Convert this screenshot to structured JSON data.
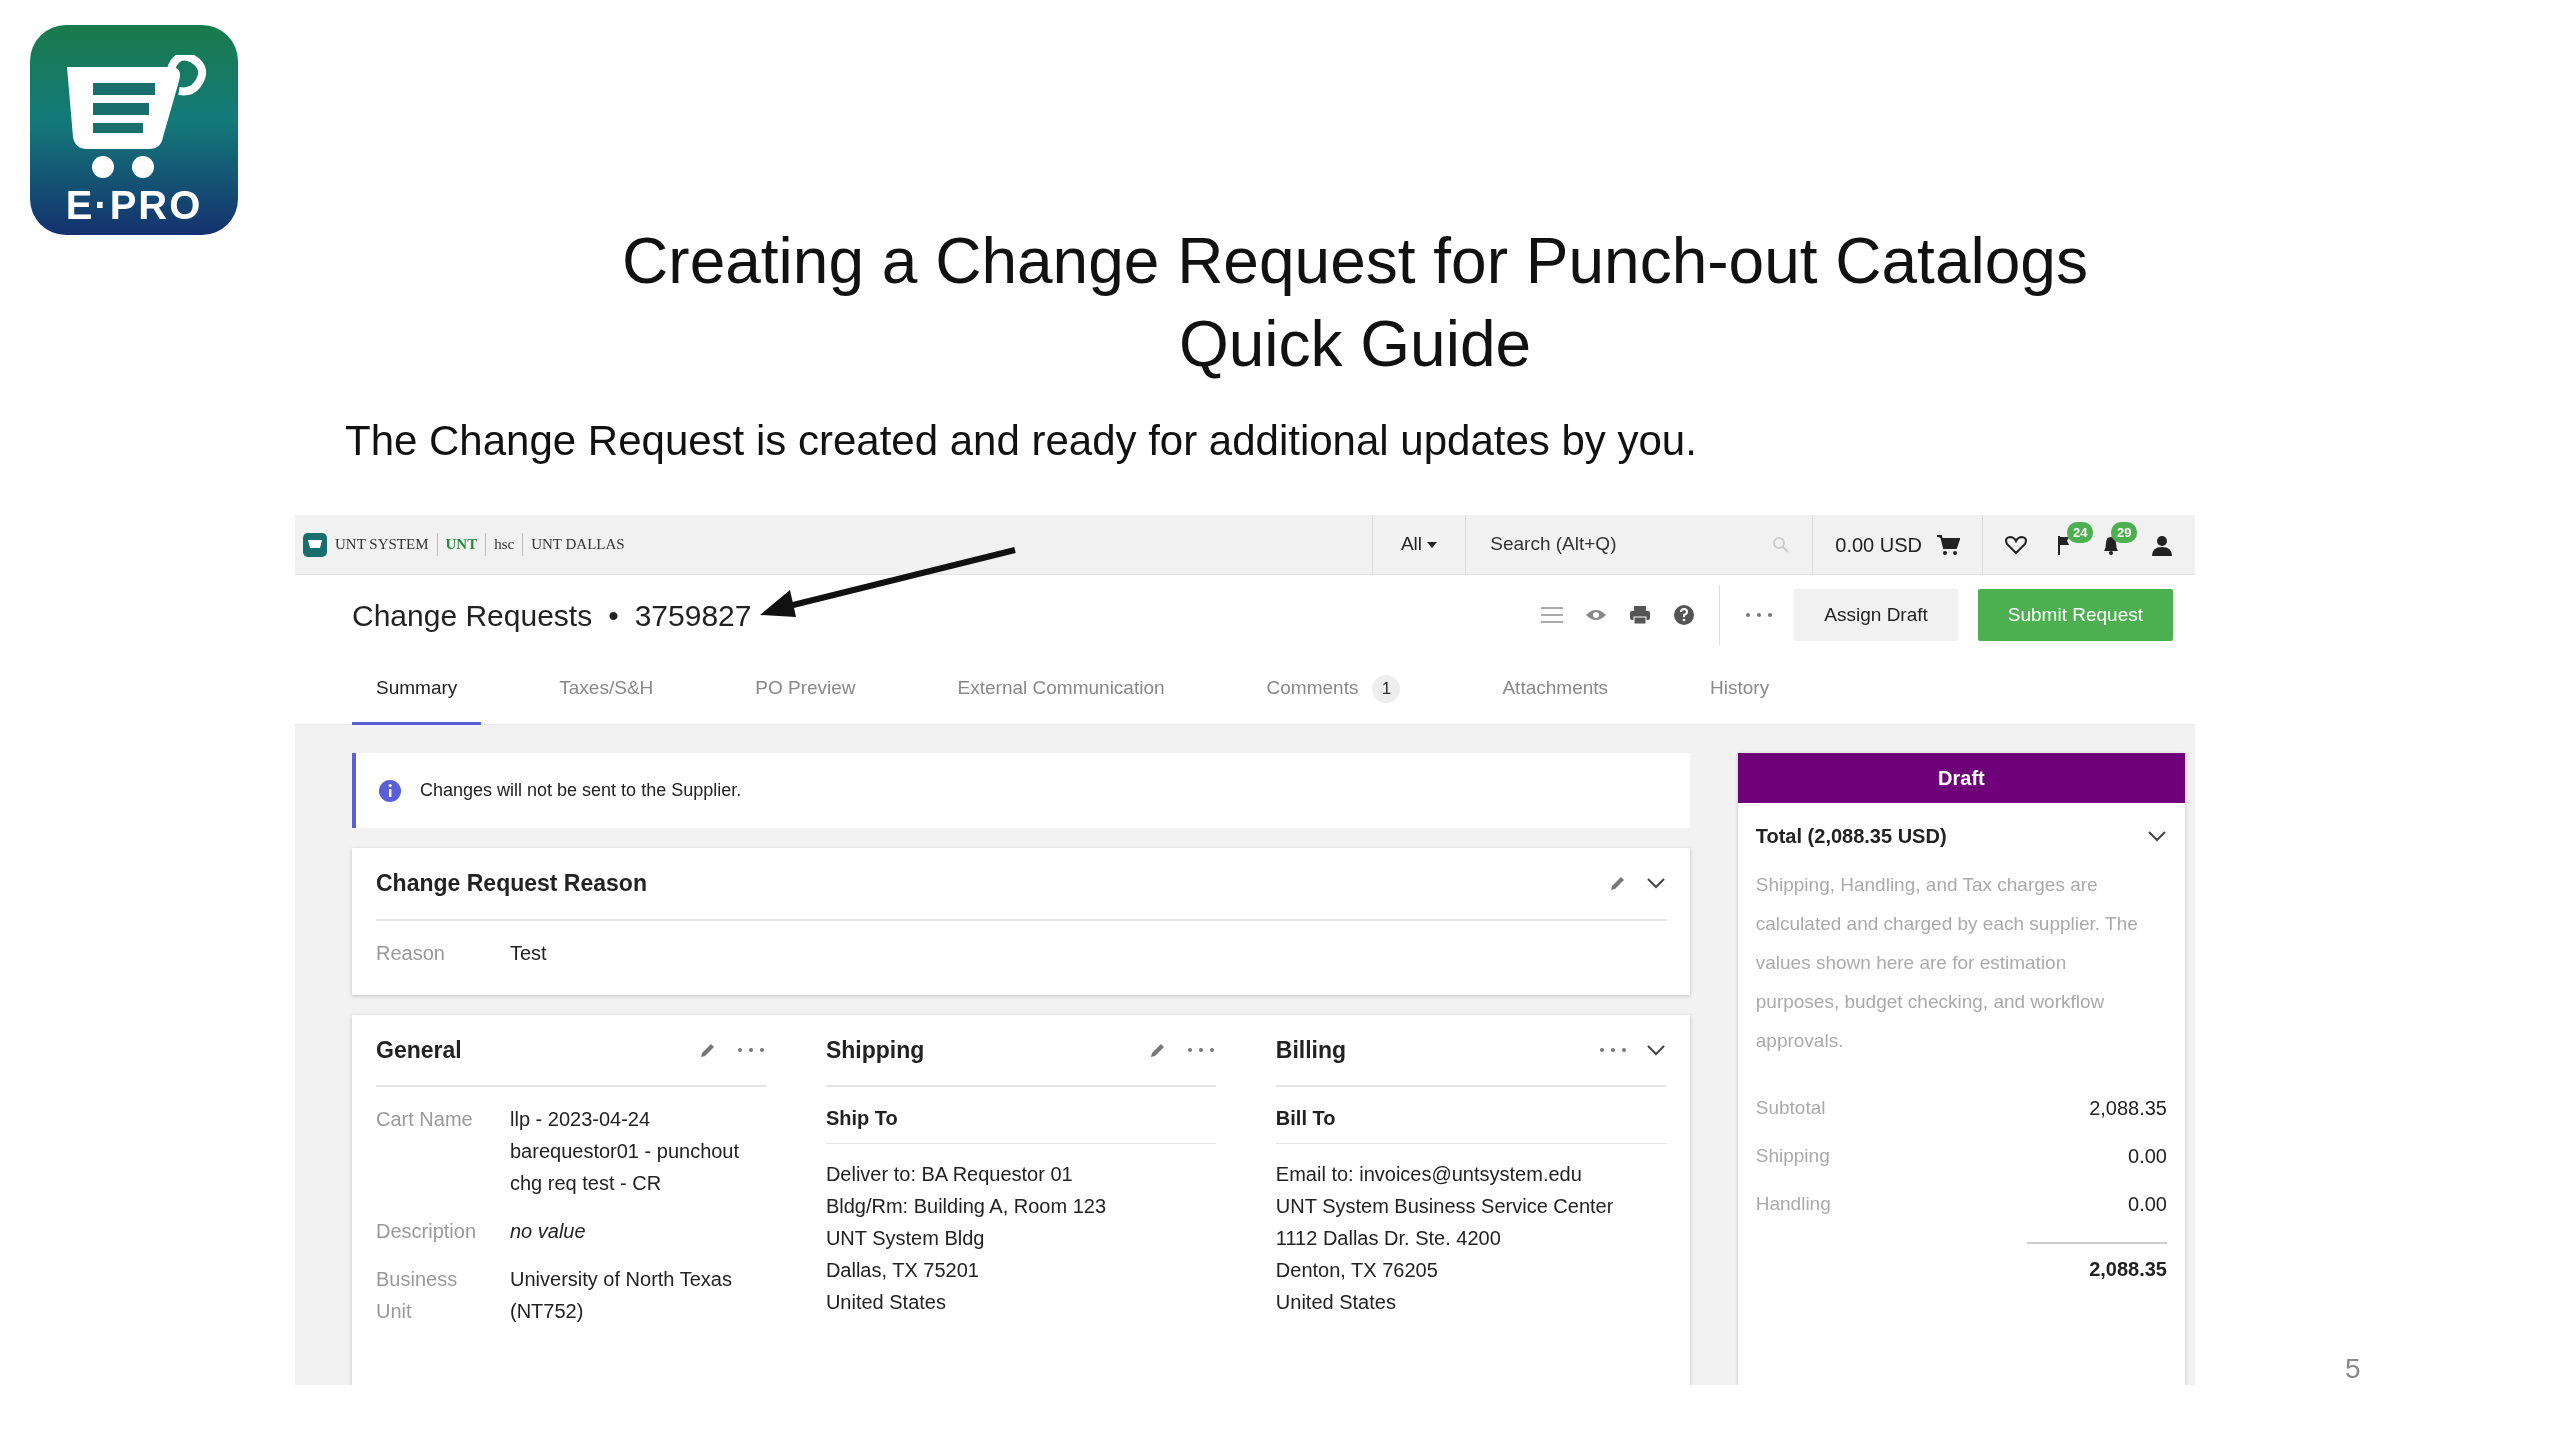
{
  "logo": {
    "text": "E·PRO"
  },
  "title_lines": [
    "Creating a Change Request for Punch-out Catalogs",
    "Quick Guide"
  ],
  "subtitle": "The Change Request is created and ready for additional updates by you.",
  "app": {
    "brand_logos": [
      "UNT SYSTEM",
      "UNT",
      "hsc",
      "UNT DALLAS"
    ],
    "search_scope": "All",
    "search": {
      "placeholder": "Search (Alt+Q)"
    },
    "cart_total": "0.00 USD",
    "notifications": [
      {
        "kind": "flag",
        "count": "24"
      },
      {
        "kind": "bell",
        "count": "29"
      }
    ],
    "page_title": "Change Requests",
    "separator": "•",
    "document_number": "3759827",
    "actions": [
      {
        "label": "Assign Draft",
        "kind": "secondary"
      },
      {
        "label": "Submit Request",
        "kind": "primary"
      }
    ],
    "tabs": [
      {
        "label": "Summary",
        "selected": true
      },
      {
        "label": "Taxes/S&H",
        "selected": false
      },
      {
        "label": "PO Preview",
        "selected": false
      },
      {
        "label": "External Communication",
        "selected": false
      },
      {
        "label": "Comments",
        "selected": false,
        "count": "1"
      },
      {
        "label": "Attachments",
        "selected": false
      },
      {
        "label": "History",
        "selected": false
      }
    ],
    "alert": "Changes will not be sent to the Supplier.",
    "reason_card": {
      "title": "Change Request Reason",
      "fields": [
        {
          "label": "Reason",
          "value": "Test"
        }
      ]
    },
    "sections": [
      {
        "title": "General",
        "editable": true,
        "collapsible": false,
        "fields": [
          {
            "label": "Cart Name",
            "value": "llp - 2023-04-24 barequestor01 - punchout chg req test - CR",
            "empty": false
          },
          {
            "label": "Description",
            "value": "no value",
            "empty": true
          },
          {
            "label": "Business Unit",
            "value": "University of North Texas (NT752)",
            "empty": false
          }
        ]
      },
      {
        "title": "Shipping",
        "editable": true,
        "collapsible": false,
        "subtitle": "Ship To",
        "lines": [
          "Deliver to: BA Requestor 01",
          "Bldg/Rm: Building A, Room 123",
          "UNT System Bldg",
          "Dallas, TX 75201",
          "United States"
        ]
      },
      {
        "title": "Billing",
        "editable": false,
        "collapsible": true,
        "subtitle": "Bill To",
        "lines": [
          "Email to: invoices@untsystem.edu",
          "UNT System Business Service Center",
          "1112 Dallas Dr. Ste. 4200",
          "Denton, TX 76205",
          "United States"
        ]
      }
    ],
    "summary": {
      "status": "Draft",
      "total_label": "Total (2,088.35 USD)",
      "note": "Shipping, Handling, and Tax charges are calculated and charged by each supplier. The values shown here are for estimation purposes, budget checking, and workflow approvals.",
      "rows": [
        {
          "label": "Subtotal",
          "value": "2,088.35"
        },
        {
          "label": "Shipping",
          "value": "0.00"
        },
        {
          "label": "Handling",
          "value": "0.00"
        }
      ],
      "grand_total": "2,088.35"
    }
  },
  "page_number": "5"
}
